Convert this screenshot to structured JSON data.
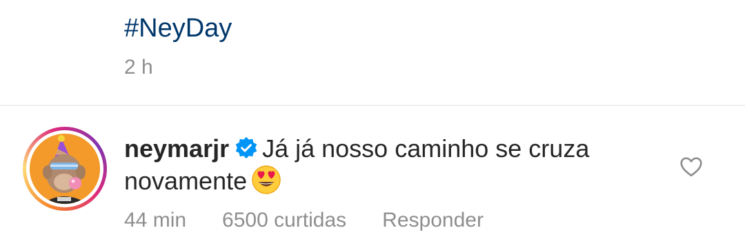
{
  "previous_comment": {
    "hashtag": "#NeyDay",
    "time": "2 h"
  },
  "comment": {
    "username": "neymarjr",
    "verified": true,
    "text_line1": "Já já nosso caminho se cruza",
    "text_line2": "novamente",
    "emoji": "heart-eyes-emoji",
    "time": "44 min",
    "likes": "6500 curtidas",
    "reply_label": "Responder",
    "like_icon": "heart-outline-icon"
  },
  "colors": {
    "hashtag_link": "#00376b",
    "secondary_text": "#8e8e8e",
    "primary_text": "#262626",
    "verified_blue": "#0095f6",
    "divider": "#efefef"
  }
}
